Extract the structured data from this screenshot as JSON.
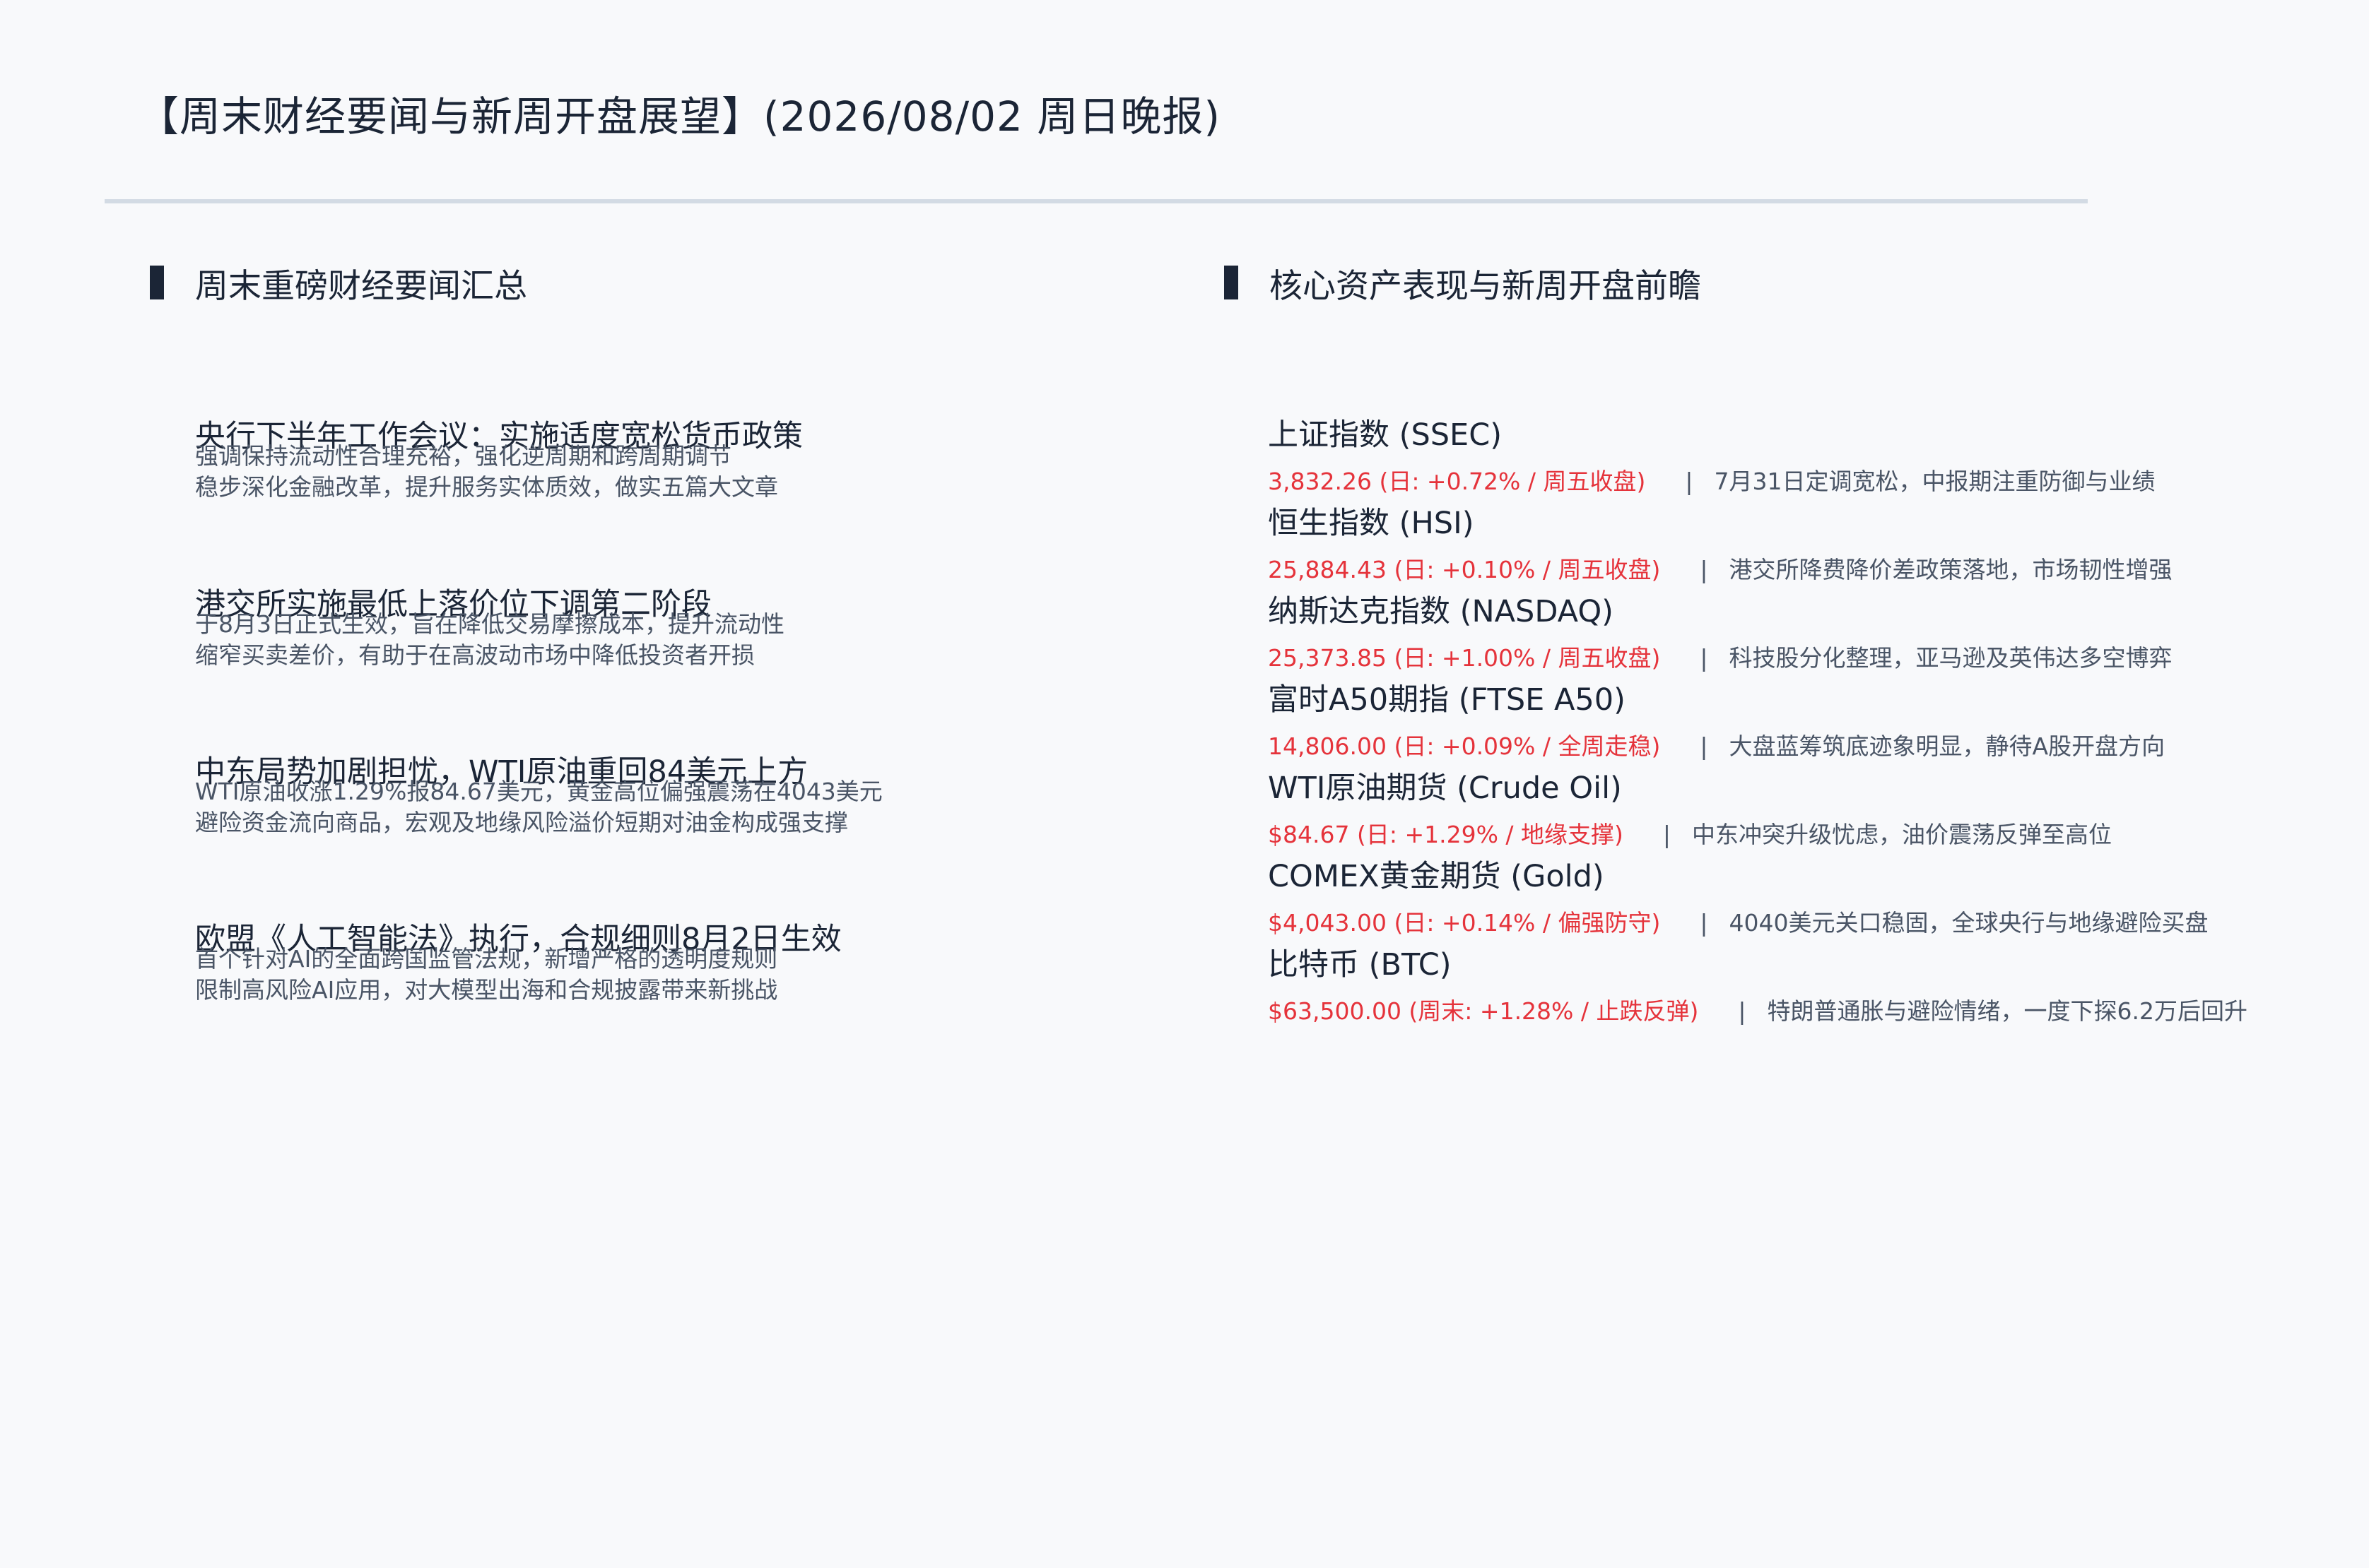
{
  "header": {
    "title": "【周末财经要闻与新周开盘展望】(2026/08/02 周日晚报)"
  },
  "left_section": {
    "title": "周末重磅财经要闻汇总",
    "items": [
      {
        "headline": "央行下半年工作会议：实施适度宽松货币政策",
        "line1": "强调保持流动性合理充裕，强化逆周期和跨周期调节",
        "line2": "稳步深化金融改革，提升服务实体质效，做实五篇大文章"
      },
      {
        "headline": "港交所实施最低上落价位下调第二阶段",
        "line1": "于8月3日正式生效，旨在降低交易摩擦成本，提升流动性",
        "line2": "缩窄买卖差价，有助于在高波动市场中降低投资者开损"
      },
      {
        "headline": "中东局势加剧担忧，WTI原油重回84美元上方",
        "line1": "WTI原油收涨1.29%报84.67美元，黄金高位偏强震荡在4043美元",
        "line2": "避险资金流向商品，宏观及地缘风险溢价短期对油金构成强支撑"
      },
      {
        "headline": "欧盟《人工智能法》执行，合规细则8月2日生效",
        "line1": "首个针对AI的全面跨国监管法规，新增严格的透明度规则",
        "line2": "限制高风险AI应用，对大模型出海和合规披露带来新挑战"
      }
    ]
  },
  "right_section": {
    "title": "核心资产表现与新周开盘前瞻",
    "separator": "|",
    "assets": [
      {
        "name": "上证指数 (SSEC)",
        "value": "3,832.26 (日: +0.72% / 周五收盘)",
        "note": "7月31日定调宽松，中报期注重防御与业绩"
      },
      {
        "name": "恒生指数 (HSI)",
        "value": "25,884.43 (日: +0.10% / 周五收盘)",
        "note": "港交所降费降价差政策落地，市场韧性增强"
      },
      {
        "name": "纳斯达克指数 (NASDAQ)",
        "value": "25,373.85 (日: +1.00% / 周五收盘)",
        "note": "科技股分化整理，亚马逊及英伟达多空博弈"
      },
      {
        "name": "富时A50期指 (FTSE A50)",
        "value": "14,806.00 (日: +0.09% / 全周走稳)",
        "note": "大盘蓝筹筑底迹象明显，静待A股开盘方向"
      },
      {
        "name": "WTI原油期货 (Crude Oil)",
        "value": "$84.67 (日: +1.29% / 地缘支撑)",
        "note": "中东冲突升级忧虑，油价震荡反弹至高位"
      },
      {
        "name": "COMEX黄金期货 (Gold)",
        "value": "$4,043.00 (日: +0.14% / 偏强防守)",
        "note": "4040美元关口稳固，全球央行与地缘避险买盘"
      },
      {
        "name": "比特币 (BTC)",
        "value": "$63,500.00 (周末: +1.28% / 止跌反弹)",
        "note": "特朗普通胀与避险情绪，一度下探6.2万后回升"
      }
    ]
  },
  "colors": {
    "accent_red": "#e5333b",
    "text_dark": "#1b2536",
    "text_muted": "#4a5566",
    "rule": "#d3dbe4"
  }
}
